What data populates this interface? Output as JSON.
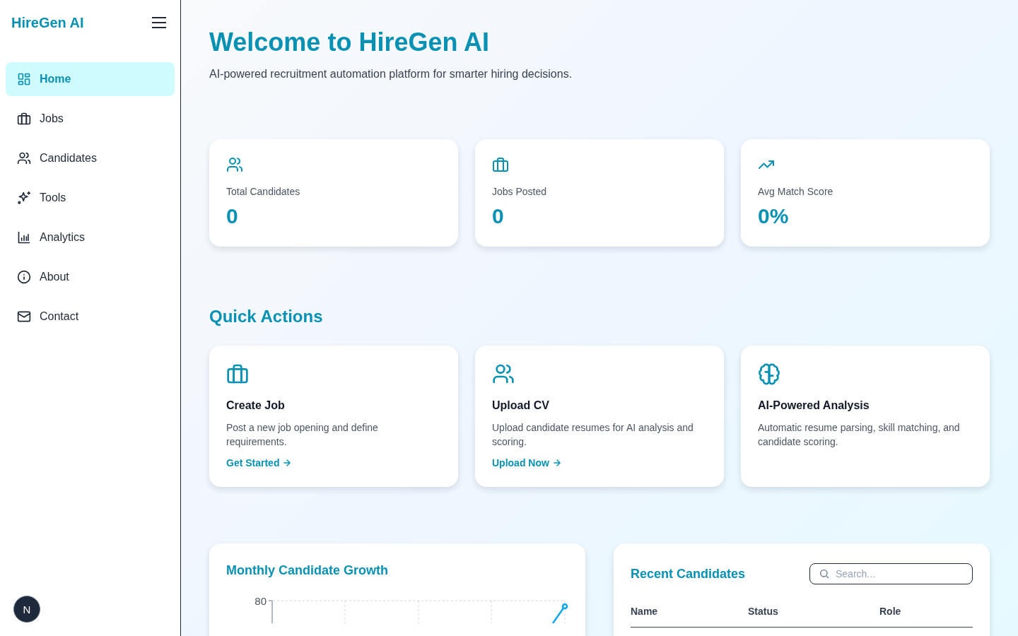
{
  "sidebar": {
    "brand": "HireGen AI",
    "items": [
      {
        "label": "Home",
        "kind": "grid",
        "selected": true
      },
      {
        "label": "Jobs",
        "kind": "briefcase",
        "selected": false
      },
      {
        "label": "Candidates",
        "kind": "users",
        "selected": false
      },
      {
        "label": "Tools",
        "kind": "sparkles",
        "selected": false
      },
      {
        "label": "Analytics",
        "kind": "chart",
        "selected": false
      },
      {
        "label": "About",
        "kind": "info",
        "selected": false
      },
      {
        "label": "Contact",
        "kind": "mail",
        "selected": false
      }
    ],
    "dev_badge": "N"
  },
  "header": {
    "title": "Welcome to HireGen AI",
    "subtitle": "AI-powered recruitment automation platform for smarter hiring decisions."
  },
  "stats": [
    {
      "kind": "users",
      "label": "Total Candidates",
      "value": "0"
    },
    {
      "kind": "briefcase",
      "label": "Jobs Posted",
      "value": "0"
    },
    {
      "kind": "trend",
      "label": "Avg Match Score",
      "value": "0%"
    }
  ],
  "quick_actions": {
    "title": "Quick Actions",
    "cards": [
      {
        "kind": "briefcase",
        "title": "Create Job",
        "description": "Post a new job opening and define requirements.",
        "link": "Get Started"
      },
      {
        "kind": "users",
        "title": "Upload CV",
        "description": "Upload candidate resumes for AI analysis and scoring.",
        "link": "Upload Now"
      },
      {
        "kind": "brain",
        "title": "AI-Powered Analysis",
        "description": "Automatic resume parsing, skill matching, and candidate scoring."
      }
    ]
  },
  "growth_chart": {
    "title": "Monthly Candidate Growth",
    "y_tick_label": "80"
  },
  "recent_candidates": {
    "title": "Recent Candidates",
    "search": {
      "placeholder": "Search..."
    },
    "columns": [
      "Name",
      "Status",
      "Role"
    ]
  }
}
